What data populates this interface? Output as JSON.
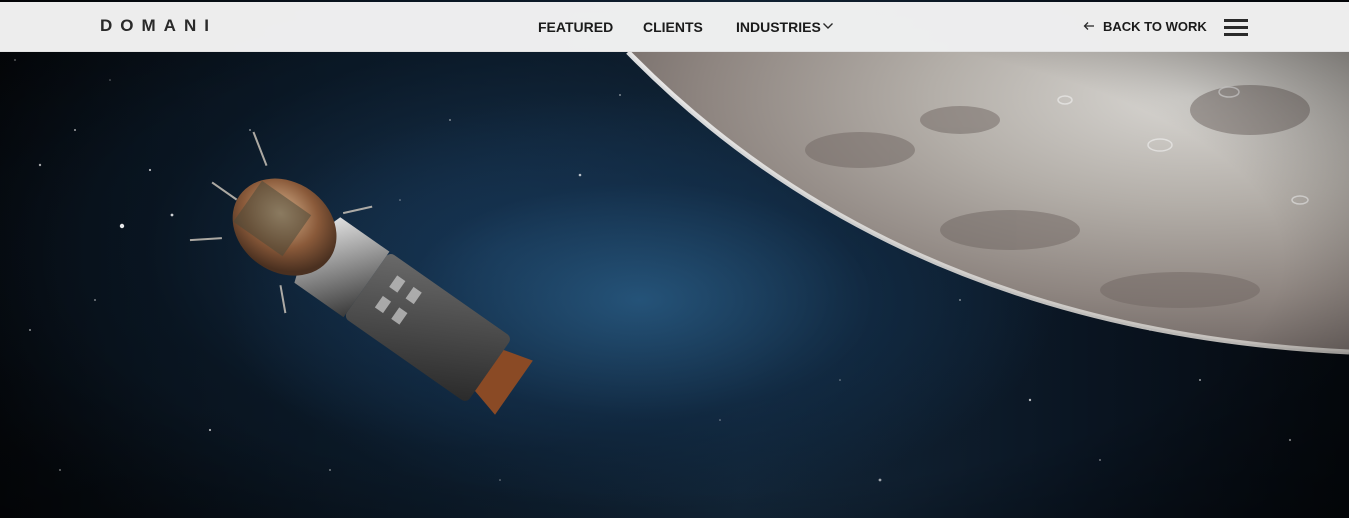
{
  "brand": {
    "logo_text": "DOMANI"
  },
  "nav": {
    "items": [
      {
        "label": "FEATURED"
      },
      {
        "label": "CLIENTS"
      },
      {
        "label": "INDUSTRIES"
      }
    ],
    "dropdown_icon": "chevron-down-icon"
  },
  "actions": {
    "back_label": "BACK TO WORK",
    "back_icon": "arrow-left-icon",
    "menu_icon": "hamburger-menu-icon"
  },
  "hero": {
    "image": "spacecraft-orbiting-moon",
    "colors": {
      "space": "#0d1c2b",
      "nebula": "#285a82",
      "moon": "#a9a49f"
    }
  }
}
